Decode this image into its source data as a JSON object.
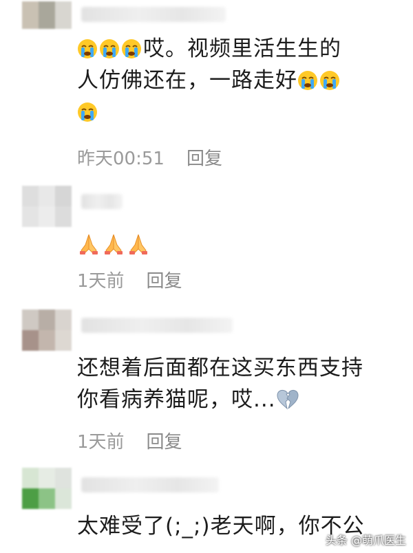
{
  "comments": [
    {
      "text_line1": "哎。视频里活生生的",
      "text_line2": "人仿佛还在，一路走好",
      "time": "昨天00:51",
      "reply": "回复"
    },
    {
      "time": "1天前",
      "reply": "回复"
    },
    {
      "text_line1": "还想着后面都在这买东西支持",
      "text_line2": "你看病养猫呢，哎...",
      "time": "1天前",
      "reply": "回复"
    },
    {
      "text_line1": "太难受了(;_;)老天啊，你不公"
    }
  ],
  "watermark": "头条 @萌爪医生",
  "icons": [
    "crying-face-icon",
    "praying-hands-icon",
    "broken-heart-icon"
  ]
}
